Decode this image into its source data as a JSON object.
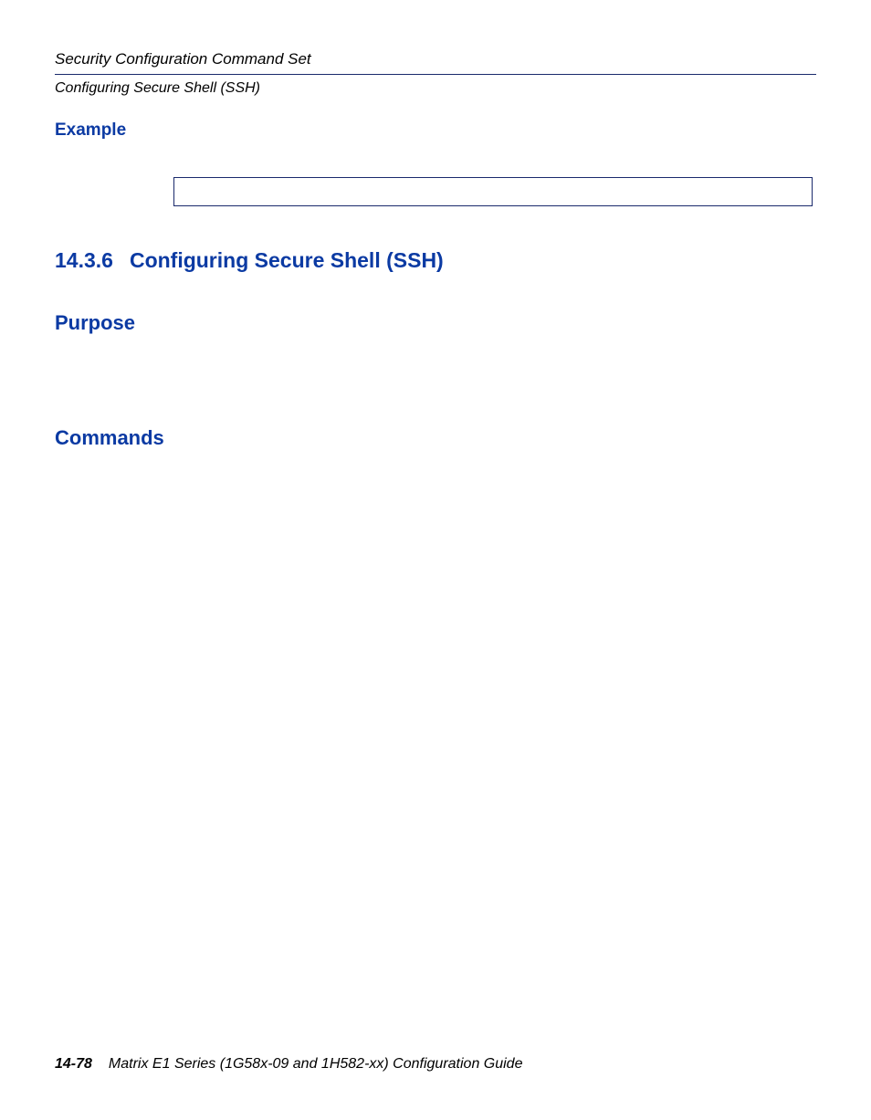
{
  "header": {
    "running_title": "Security Configuration Command Set",
    "running_sub": "Configuring Secure Shell (SSH)"
  },
  "headings": {
    "example": "Example",
    "section_number": "14.3.6",
    "section_title": "Configuring Secure Shell (SSH)",
    "purpose": "Purpose",
    "commands": "Commands"
  },
  "code_box": {
    "content": ""
  },
  "footer": {
    "page_number": "14-78",
    "doc_title": "Matrix E1 Series (1G58x-09 and 1H582-xx) Configuration Guide"
  }
}
